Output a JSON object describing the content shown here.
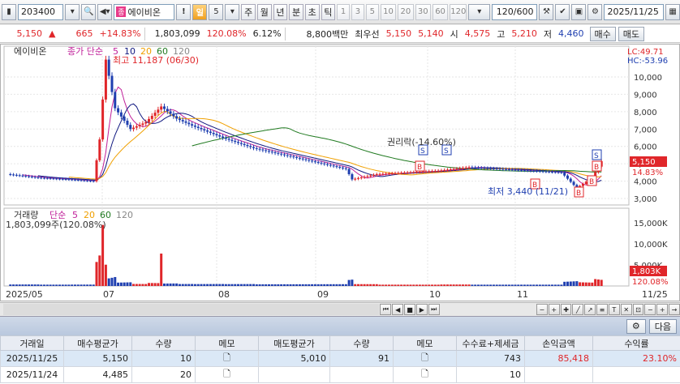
{
  "toolbar": {
    "code": "203400",
    "name_tag": "종",
    "name": "에이비온",
    "period_day": "일",
    "period_num": "5",
    "periods": [
      "주",
      "월",
      "년",
      "분",
      "초",
      "틱"
    ],
    "nums": [
      "1",
      "3",
      "5",
      "10",
      "20",
      "30",
      "60",
      "120"
    ],
    "count": "120/600",
    "date": "2025/11/25"
  },
  "pricebar": {
    "price": "5,150",
    "change": "665",
    "change_pct": "+14.83%",
    "volume": "1,803,099",
    "vol_ratio": "120.08%",
    "turnover": "6.12%",
    "amount": "8,800백만",
    "label_best": "최우선",
    "best_ask": "5,150",
    "best_bid": "5,140",
    "open_label": "시",
    "open": "4,575",
    "high_label": "고",
    "high": "5,210",
    "low_label": "저",
    "low": "4,460",
    "buy_btn": "매수",
    "sell_btn": "매도"
  },
  "chart": {
    "price_title": "에이비온",
    "ma_label": "종가 단순",
    "ma_periods": [
      "5",
      "10",
      "20",
      "60",
      "120"
    ],
    "ma_colors": [
      "#c0209a",
      "#101880",
      "#f0a000",
      "#207a20",
      "#888888"
    ],
    "high_annot": "최고 11,187 (06/30)",
    "low_annot": "최저 3,440 (11/21)",
    "rights_annot": "권리락(-14.60%)",
    "lc": "LC:49.71",
    "hc": "HC:-53.96",
    "y_ticks": [
      "10,000",
      "9,000",
      "8,000",
      "7,000",
      "6,000",
      "5,000",
      "4,000",
      "3,000"
    ],
    "cur_price_tag": "5,150",
    "cur_pct_tag": "14.83%",
    "vol_title": "거래량",
    "vol_ma_label": "단순",
    "vol_ma_periods": [
      "5",
      "20",
      "60",
      "120"
    ],
    "vol_value": "1,803,099주(120.08%)",
    "vol_ticks": [
      "15,000K",
      "10,000K",
      "5,000K"
    ],
    "vol_tag": "1,803K",
    "vol_pct_tag": "120.08%",
    "x_labels": [
      "2025/05",
      "07",
      "08",
      "09",
      "10",
      "11",
      "11/25"
    ],
    "signal_s": "S",
    "signal_b": "B",
    "colors": {
      "up": "#e0262a",
      "down": "#1f3fb0"
    }
  },
  "midbar": {
    "next_btn": "다음"
  },
  "table": {
    "headers": [
      "거래일",
      "매수평균가",
      "수량",
      "메모",
      "매도평균가",
      "수량",
      "메모",
      "수수료+제세금",
      "손익금액",
      "수익률"
    ],
    "rows": [
      [
        "2025/11/25",
        "5,150",
        "10",
        "",
        "5,010",
        "91",
        "",
        "743",
        "85,418",
        "23.10%"
      ],
      [
        "2025/11/24",
        "4,485",
        "20",
        "",
        "",
        "",
        "",
        "10",
        "",
        ""
      ]
    ]
  }
}
